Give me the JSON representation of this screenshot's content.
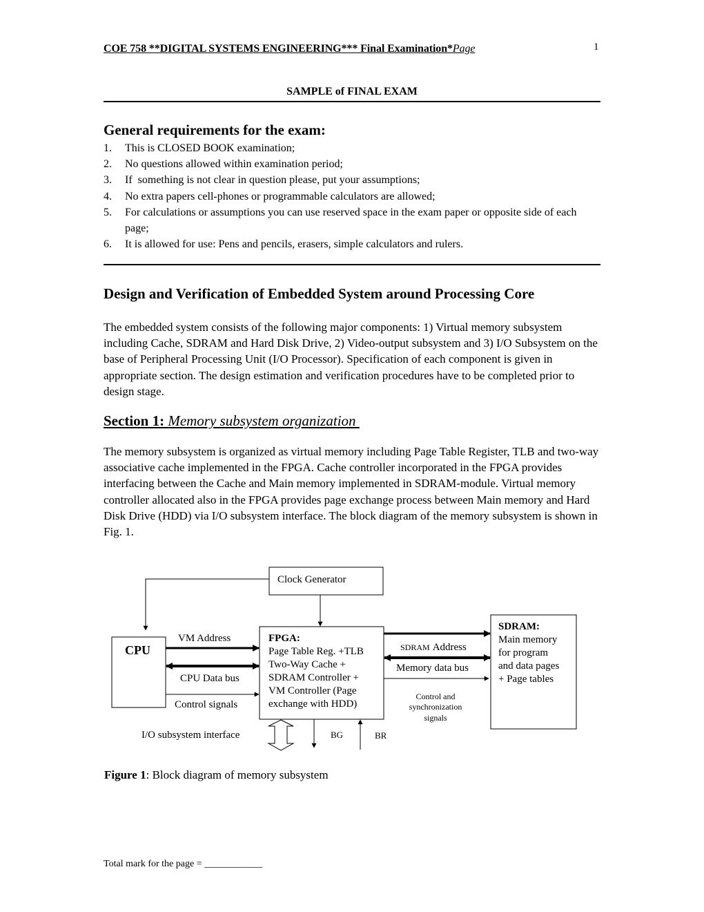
{
  "header": {
    "title": "COE 758 **DIGITAL SYSTEMS ENGINEERING*** Final Examination*",
    "page_word": "Page",
    "page_number": "1"
  },
  "subtitle": "SAMPLE of FINAL EXAM",
  "requirements": {
    "heading": "General requirements for the exam:",
    "items": [
      {
        "num": "1.",
        "text": "This is CLOSED BOOK examination;"
      },
      {
        "num": "2.",
        "text": "No questions allowed within examination period;"
      },
      {
        "num": "3.",
        "text": "If  something is not clear in question please, put your assumptions;"
      },
      {
        "num": "4.",
        "text": "No extra papers cell-phones or programmable calculators are allowed;"
      },
      {
        "num": "5.",
        "text": "For calculations or assumptions you can use reserved space in the exam paper or opposite side of each page;"
      },
      {
        "num": "6.",
        "text": "It is allowed for use: Pens and pencils, erasers, simple calculators and rulers."
      }
    ]
  },
  "design": {
    "heading": "Design and Verification of Embedded System around Processing Core",
    "paragraph": "The embedded system consists of the following major components: 1) Virtual memory subsystem including Cache, SDRAM and Hard Disk Drive, 2) Video-output subsystem and 3) I/O Subsystem on the base of Peripheral Processing Unit (I/O Processor). Specification of each component is given in appropriate section. The design estimation and verification procedures have to be completed prior to design stage."
  },
  "section1": {
    "label": "Section 1:",
    "title": "Memory subsystem organization ",
    "paragraph": "The memory subsystem is organized as virtual memory including Page Table Register, TLB and two-way associative cache implemented in the FPGA. Cache controller incorporated in the FPGA provides interfacing between the Cache and Main memory implemented in SDRAM-module. Virtual memory controller allocated also in the FPGA provides page exchange process between Main memory and Hard Disk Drive (HDD) via I/O subsystem interface. The block diagram of the memory subsystem is shown in Fig. 1."
  },
  "diagram": {
    "clock": "Clock Generator",
    "cpu": "CPU",
    "fpga_title": "FPGA:",
    "fpga_lines": [
      "Page Table Reg. +TLB",
      "Two-Way Cache +",
      "SDRAM Controller +",
      "VM Controller (Page",
      "exchange with HDD)"
    ],
    "sdram_title": "SDRAM:",
    "sdram_lines": [
      "Main memory",
      "for program",
      "and data pages",
      "+ Page tables"
    ],
    "vm_address": "VM Address",
    "cpu_data_bus": "CPU Data bus",
    "control_signals": "Control signals",
    "sdram_address_small": "SDRAM",
    "sdram_address": "Address",
    "memory_data_bus": "Memory data bus",
    "ctrl_sync": [
      "Control and",
      "synchronization",
      "signals"
    ],
    "io_interface": "I/O subsystem interface",
    "bg": "BG",
    "br": "BR"
  },
  "caption": {
    "label": "Figure 1",
    "text": ": Block diagram of memory subsystem"
  },
  "footer": "Total mark for the page = ____________"
}
